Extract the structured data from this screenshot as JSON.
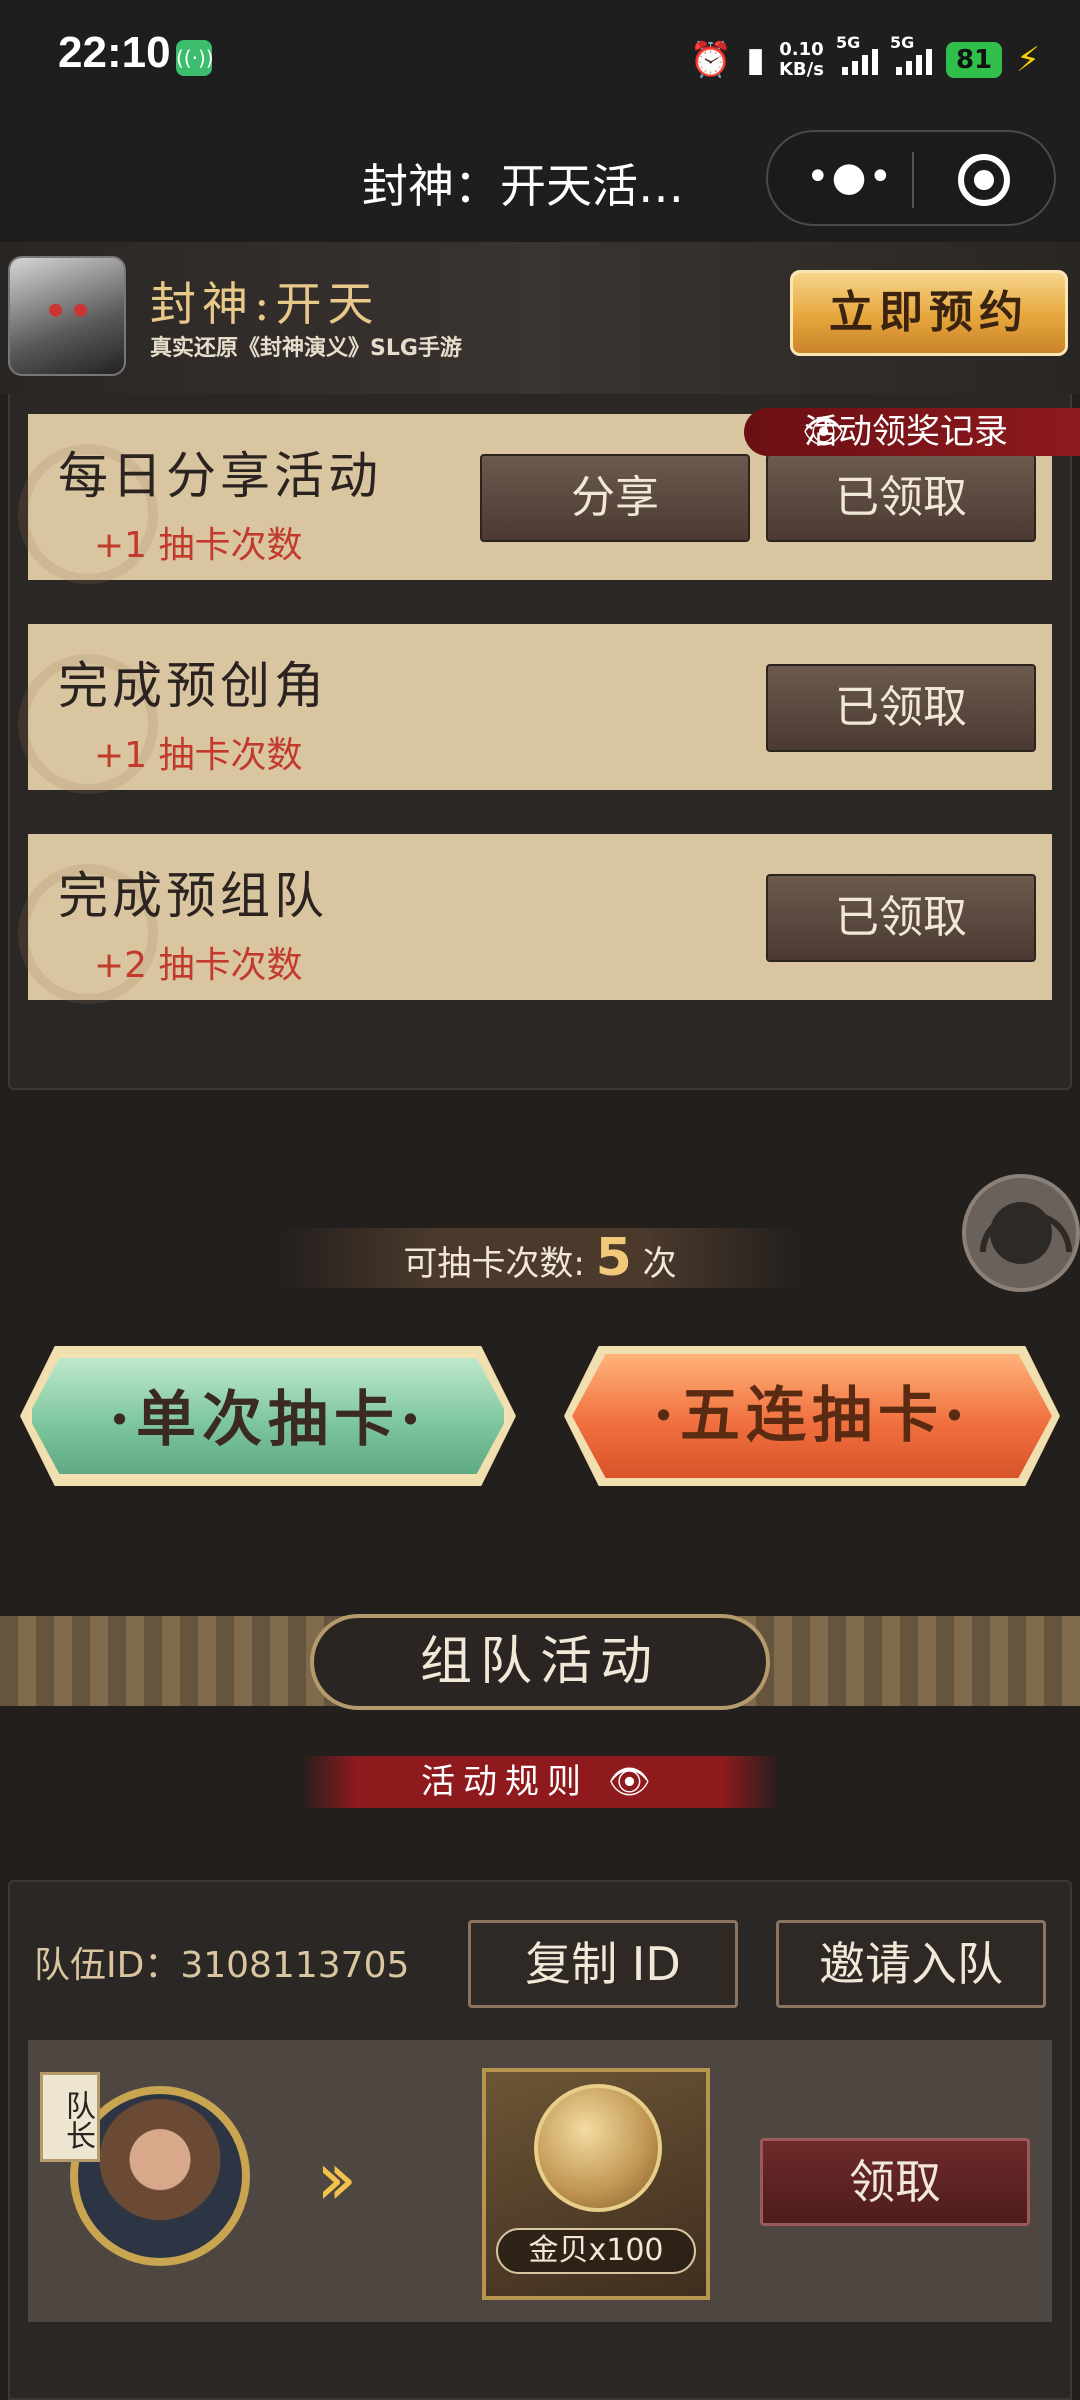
{
  "status_bar": {
    "time": "22:10",
    "net_speed_value": "0.10",
    "net_speed_unit": "KB/s",
    "sim1": "5G",
    "sim2": "5G",
    "battery": "81"
  },
  "titlebar": {
    "title": "封神：开天活…",
    "more_icon": "more-dots-icon",
    "close_icon": "target-close-icon"
  },
  "banner": {
    "game_name": "封神:开天",
    "subtitle": "真实还原《封神演义》SLG手游",
    "reserve_button": "立即预约"
  },
  "activity_record": "活动领奖记录",
  "tasks": [
    {
      "name": "每日分享活动",
      "reward": "+1 抽卡次数",
      "share_button": "分享",
      "status_button": "已领取"
    },
    {
      "name": "完成预创角",
      "reward": "+1 抽卡次数",
      "status_button": "已领取"
    },
    {
      "name": "完成预组队",
      "reward": "+2 抽卡次数",
      "status_button": "已领取"
    }
  ],
  "draw": {
    "count_label": "可抽卡次数:",
    "count_value": "5",
    "count_unit": "次",
    "single_button": "·单次抽卡·",
    "five_button": "·五连抽卡·"
  },
  "team": {
    "section_title": "组队活动",
    "rules_link": "活动规则",
    "team_id_label": "队伍ID：3108113705",
    "copy_button": "复制 ID",
    "invite_button": "邀请入队",
    "captain_badge": "队长",
    "reward_label": "金贝x100",
    "claim_button": "领取"
  }
}
